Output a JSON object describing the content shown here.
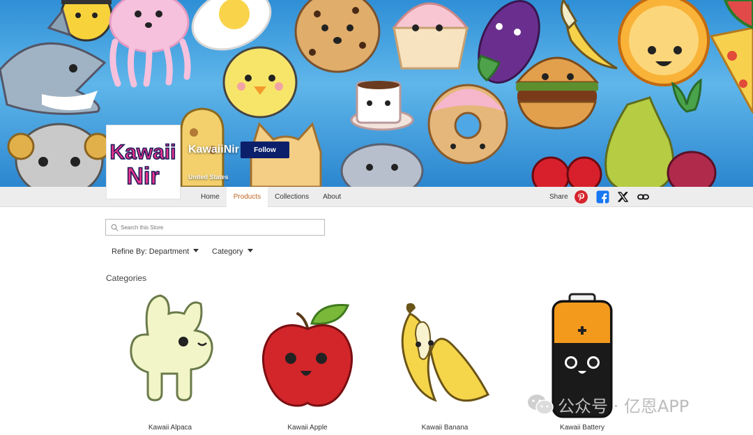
{
  "store": {
    "name": "KawaiiNir",
    "country": "United States",
    "follow_label": "Follow",
    "logo_text_line1": "Kawaii",
    "logo_text_line2": "Nir"
  },
  "nav": {
    "tabs": [
      {
        "label": "Home",
        "active": false
      },
      {
        "label": "Products",
        "active": true
      },
      {
        "label": "Collections",
        "active": false
      },
      {
        "label": "About",
        "active": false
      }
    ],
    "share_label": "Share",
    "share_icons": [
      "pinterest-icon",
      "facebook-icon",
      "x-icon",
      "link-icon"
    ]
  },
  "search": {
    "placeholder": "Search this Store",
    "value": ""
  },
  "filters": {
    "department_label": "Refine By: Department",
    "category_label": "Category"
  },
  "categories_title": "Categories",
  "categories": [
    {
      "label": "Kawaii Alpaca",
      "icon": "alpaca-icon"
    },
    {
      "label": "Kawaii Apple",
      "icon": "apple-icon"
    },
    {
      "label": "Kawaii Banana",
      "icon": "banana-icon"
    },
    {
      "label": "Kawaii Battery",
      "icon": "battery-icon"
    }
  ],
  "watermark": {
    "text": "公众号 · 亿恩APP"
  },
  "colors": {
    "accent_tab": "#c0641e",
    "follow_button": "#0b1f6b",
    "banner_blue": "#4aa8e6",
    "pinterest": "#d6252d",
    "facebook": "#1877f2"
  }
}
